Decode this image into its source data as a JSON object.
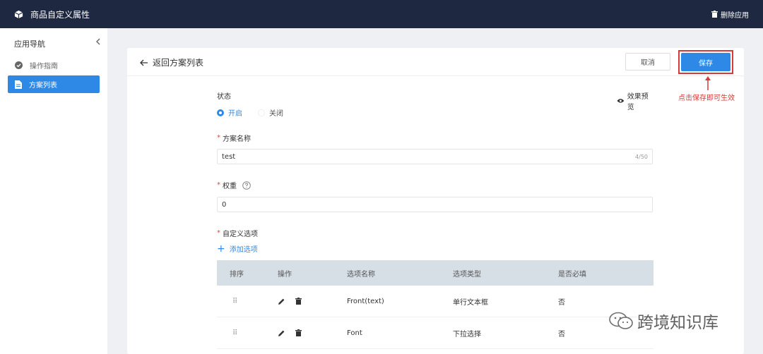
{
  "topbar": {
    "title": "商品自定义属性",
    "delete_app": "删除应用"
  },
  "sidebar": {
    "title": "应用导航",
    "items": [
      {
        "label": "操作指南",
        "icon": "check-circle-icon"
      },
      {
        "label": "方案列表",
        "icon": "document-icon"
      }
    ]
  },
  "header": {
    "back_label": "返回方案列表",
    "cancel_label": "取消",
    "save_label": "保存"
  },
  "form": {
    "status_label": "状态",
    "preview_label": "效果预览",
    "status_options": [
      "开启",
      "关闭"
    ],
    "status_selected": "开启",
    "name_label": "方案名称",
    "name_value": "test",
    "name_count": "4/50",
    "weight_label": "权重",
    "weight_value": "0",
    "custom_label": "自定义选项",
    "add_option": "添加选项"
  },
  "table": {
    "columns": [
      "排序",
      "操作",
      "选项名称",
      "选项类型",
      "是否必填"
    ],
    "rows": [
      {
        "drag": "⠿",
        "name": "Front(text)",
        "type": "单行文本框",
        "required": "否"
      },
      {
        "drag": "⠿",
        "name": "Font",
        "type": "下拉选择",
        "required": "否"
      }
    ]
  },
  "annotation": {
    "text": "点击保存即可生效"
  },
  "watermark": {
    "text": "跨境知识库"
  },
  "colors": {
    "topbar": "#1e2840",
    "primary": "#2e89e6",
    "annotation": "#d63a3a"
  }
}
